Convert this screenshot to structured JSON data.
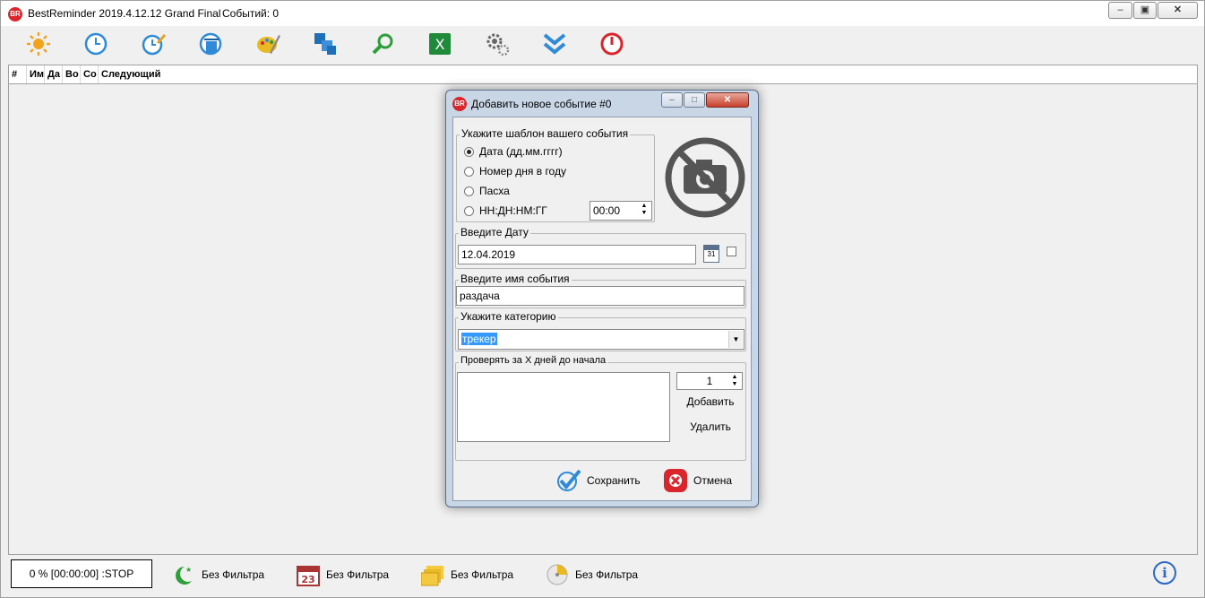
{
  "window": {
    "title": "BestReminder 2019.4.12.12 Grand Final",
    "events_label": "Событий:  0",
    "app_icon_text": "BR"
  },
  "toolbar": {
    "buttons": [
      {
        "name": "sun-icon",
        "color": "#f2a31b"
      },
      {
        "name": "clock-icon",
        "color": "#2f8ad8"
      },
      {
        "name": "clock-edit-icon",
        "color": "#2f8ad8"
      },
      {
        "name": "clock-delete-icon",
        "color": "#2f8ad8"
      },
      {
        "name": "palette-icon",
        "color": "#e8b923"
      },
      {
        "name": "windows-icon",
        "color": "#1e6fb8"
      },
      {
        "name": "search-icon",
        "color": "#2e9e3a"
      },
      {
        "name": "excel-icon",
        "color": "#1f8a3a"
      },
      {
        "name": "gears-icon",
        "color": "#666666"
      },
      {
        "name": "double-chevron-down-icon",
        "color": "#2f8ad8"
      },
      {
        "name": "power-icon",
        "color": "#d9262c"
      }
    ],
    "excel_letter": "X"
  },
  "list": {
    "columns": [
      "#",
      "Им",
      "Да",
      "Во",
      "Со",
      "Следующий"
    ]
  },
  "status": {
    "progress": "0 % [00:00:00] :STOP",
    "filters": [
      {
        "icon": "moon-star-icon",
        "label": "Без Фильтра"
      },
      {
        "icon": "calendar-23-icon",
        "label": "Без Фильтра"
      },
      {
        "icon": "folders-icon",
        "label": "Без Фильтра"
      },
      {
        "icon": "pie-disk-icon",
        "label": "Без Фильтра"
      }
    ],
    "calendar_number": "23",
    "info_glyph": "i"
  },
  "dialog": {
    "title": "Добавить новое событие #0",
    "icon_text": "BR",
    "template_group": {
      "label": "Укажите шаблон вашего события",
      "options": [
        {
          "label": "Дата (дд.мм.гггг)",
          "checked": true
        },
        {
          "label": "Номер дня в году",
          "checked": false
        },
        {
          "label": "Пасха",
          "checked": false
        },
        {
          "label": "НН:ДН:НМ:ГГ",
          "checked": false
        }
      ],
      "time_value": "00:00"
    },
    "date_group": {
      "label": "Введите Дату",
      "value": "12.04.2019",
      "calendar_day": "31"
    },
    "name_group": {
      "label": "Введите  имя события",
      "value": "раздача"
    },
    "category_group": {
      "label": "Укажите категорию",
      "value": "трекер"
    },
    "days_group": {
      "label": "Проверять за X дней до начала",
      "spin_value": "1",
      "add_label": "Добавить",
      "delete_label": "Удалить"
    },
    "save_label": "Сохранить",
    "cancel_label": "Отмена"
  }
}
